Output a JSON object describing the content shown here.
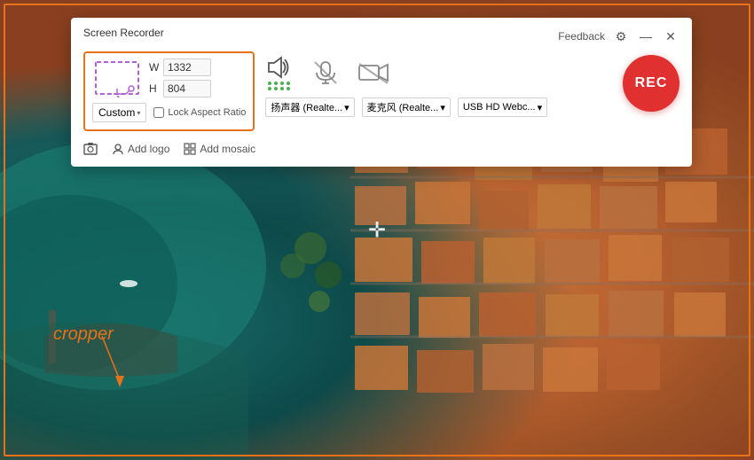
{
  "app": {
    "title": "Screen Recorder",
    "feedback_label": "Feedback"
  },
  "toolbar": {
    "region": {
      "width_label": "W",
      "height_label": "H",
      "width_value": "1332",
      "height_value": "804",
      "preset_label": "Custom",
      "lock_label": "Lock Aspect Ratio"
    },
    "audio": {
      "speaker_dropdown": "扬声器 (Realte...",
      "mic_dropdown": "麦克风 (Realte...",
      "camera_dropdown": "USB HD Webc..."
    },
    "rec_label": "REC",
    "add_logo_label": "Add logo",
    "add_mosaic_label": "Add mosaic"
  },
  "cropper_label": "cropper",
  "icons": {
    "speaker": "🔊",
    "mic_muted": "🎤",
    "camera_muted": "📷",
    "settings": "⚙",
    "minimize": "—",
    "close": "✕",
    "screenshot": "📷",
    "logo": "👤",
    "mosaic": "⊞",
    "move": "✛",
    "dropdown_arrow": "▾"
  }
}
